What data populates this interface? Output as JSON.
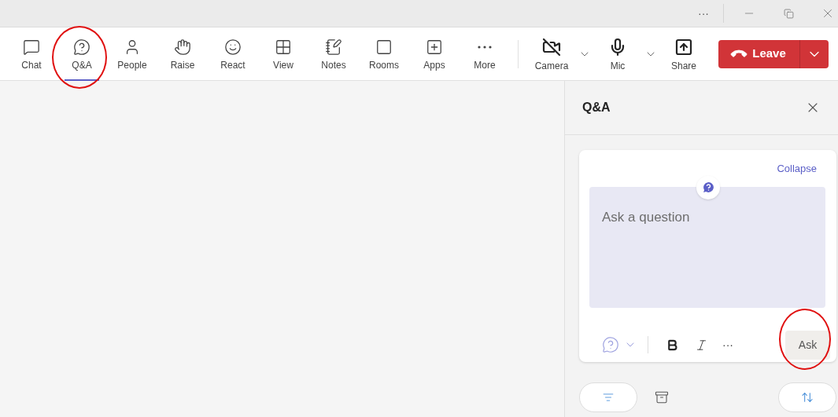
{
  "title_bar": {
    "more": "···"
  },
  "toolbar": [
    {
      "label": "Chat",
      "selected": false,
      "circled": false
    },
    {
      "label": "Q&A",
      "selected": true,
      "circled": true
    },
    {
      "label": "People",
      "selected": false,
      "circled": false
    },
    {
      "label": "Raise",
      "selected": false,
      "circled": false
    },
    {
      "label": "React",
      "selected": false,
      "circled": false
    },
    {
      "label": "View",
      "selected": false,
      "circled": false
    },
    {
      "label": "Notes",
      "selected": false,
      "circled": false
    },
    {
      "label": "Rooms",
      "selected": false,
      "circled": false
    },
    {
      "label": "Apps",
      "selected": false,
      "circled": false
    },
    {
      "label": "More",
      "selected": false,
      "circled": false
    }
  ],
  "devices": [
    {
      "label": "Camera",
      "kind": "camera"
    },
    {
      "label": "Mic",
      "kind": "mic"
    },
    {
      "label": "Share",
      "kind": "share"
    }
  ],
  "leave_button": {
    "label": "Leave"
  },
  "panel": {
    "title": "Q&A",
    "collapse": "Collapse",
    "question": {
      "placeholder": "Ask a question"
    },
    "more_formatting": "···",
    "ask_button": {
      "label": "Ask",
      "circled": true
    }
  }
}
